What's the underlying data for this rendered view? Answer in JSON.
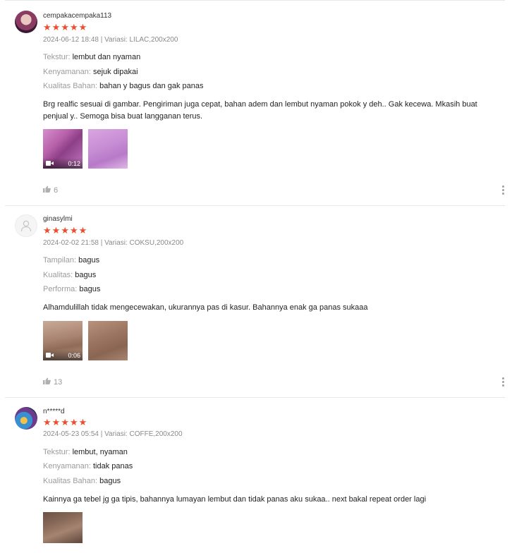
{
  "reviews": [
    {
      "username": "cempakacempaka113",
      "rating": 5,
      "meta": "2024-06-12 18:48 | Variasi: LILAC,200x200",
      "attributes": [
        {
          "key": "Tekstur:",
          "value": "lembut dan nyaman"
        },
        {
          "key": "Kenyamanan:",
          "value": "sejuk dipakai"
        },
        {
          "key": "Kualitas Bahan:",
          "value": "bahan y bagus dan gak panas"
        }
      ],
      "comment": "Brg realfic sesuai di gambar. Pengiriman juga cepat, bahan adem dan lembut nyaman pokok y deh.. Gak kecewa. Mkasih buat penjual y.. Semoga bisa buat langganan terus.",
      "video_duration": "0:12",
      "likes": "6"
    },
    {
      "username": "ginasylmi",
      "rating": 5,
      "meta": "2024-02-02 21:58 | Variasi: COKSU,200x200",
      "attributes": [
        {
          "key": "Tampilan:",
          "value": "bagus"
        },
        {
          "key": "Kualitas:",
          "value": "bagus"
        },
        {
          "key": "Performa:",
          "value": "bagus"
        }
      ],
      "comment": "Alhamdulillah tidak mengecewakan, ukurannya pas di kasur. Bahannya enak ga panas sukaaa",
      "video_duration": "0:06",
      "likes": "13"
    },
    {
      "username": "n*****d",
      "rating": 5,
      "meta": "2024-05-23 05:54 | Variasi: COFFE,200x200",
      "attributes": [
        {
          "key": "Tekstur:",
          "value": "lembut, nyaman"
        },
        {
          "key": "Kenyamanan:",
          "value": "tidak panas"
        },
        {
          "key": "Kualitas Bahan:",
          "value": "bagus"
        }
      ],
      "comment": "Kainnya ga tebel jg ga tipis, bahannya lumayan lembut dan tidak panas aku sukaa.. next bakal repeat order lagi"
    }
  ],
  "colors": {
    "star": "#ee4d2d",
    "muted": "#9b9b9b"
  },
  "icons": {
    "like": "thumbs-up-icon",
    "video": "video-camera-icon",
    "more": "more-vertical-icon"
  }
}
